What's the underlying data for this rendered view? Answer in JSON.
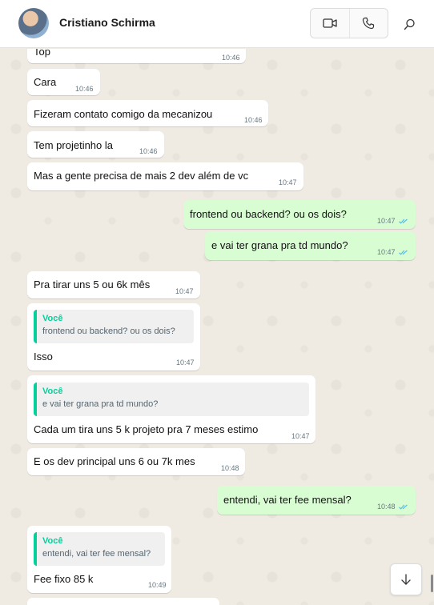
{
  "contact": {
    "name": "Cristiano Schirma"
  },
  "header_icons": {
    "video": "video-camera-icon",
    "voice": "phone-icon",
    "search": "search-icon"
  },
  "colors": {
    "incoming": "#ffffff",
    "outgoing": "#d9fdd3",
    "accent": "#06cf9c",
    "read_ticks": "#53bdeb"
  },
  "messages": [
    {
      "dir": "in",
      "text": "Top",
      "time": "10:46"
    },
    {
      "dir": "in",
      "text": "Cara",
      "time": "10:46"
    },
    {
      "dir": "in",
      "text": "Fizeram contato comigo da mecanizou",
      "time": "10:46"
    },
    {
      "dir": "in",
      "text": "Tem projetinho la",
      "time": "10:46"
    },
    {
      "dir": "in",
      "text": "Mas a gente precisa de mais 2 dev além de vc",
      "time": "10:47"
    },
    {
      "dir": "out",
      "text": "frontend ou backend? ou os dois?",
      "time": "10:47",
      "status": "read"
    },
    {
      "dir": "out",
      "text": "e vai ter grana pra td mundo?",
      "time": "10:47",
      "status": "read"
    },
    {
      "dir": "in",
      "text": "Pra tirar uns 5 ou 6k mês",
      "time": "10:47"
    },
    {
      "dir": "in",
      "text": "Isso",
      "time": "10:47",
      "quote": {
        "author": "Você",
        "text": "frontend ou backend? ou os dois?"
      }
    },
    {
      "dir": "in",
      "text": "Cada um tira uns 5 k projeto pra 7 meses estimo",
      "time": "10:47",
      "quote": {
        "author": "Você",
        "text": "e vai ter grana pra td mundo?"
      }
    },
    {
      "dir": "in",
      "text": "E os dev principal uns 6 ou 7k mes",
      "time": "10:48"
    },
    {
      "dir": "out",
      "text": "entendi, vai ter fee mensal?",
      "time": "10:48",
      "status": "read"
    },
    {
      "dir": "in",
      "text": "Fee fixo 85 k",
      "time": "10:49",
      "quote": {
        "author": "Você",
        "text": "entendi, vai ter fee mensal?"
      }
    },
    {
      "dir": "in",
      "text": "",
      "time": ""
    }
  ],
  "scroll_button": {
    "icon": "arrow-down-icon"
  }
}
